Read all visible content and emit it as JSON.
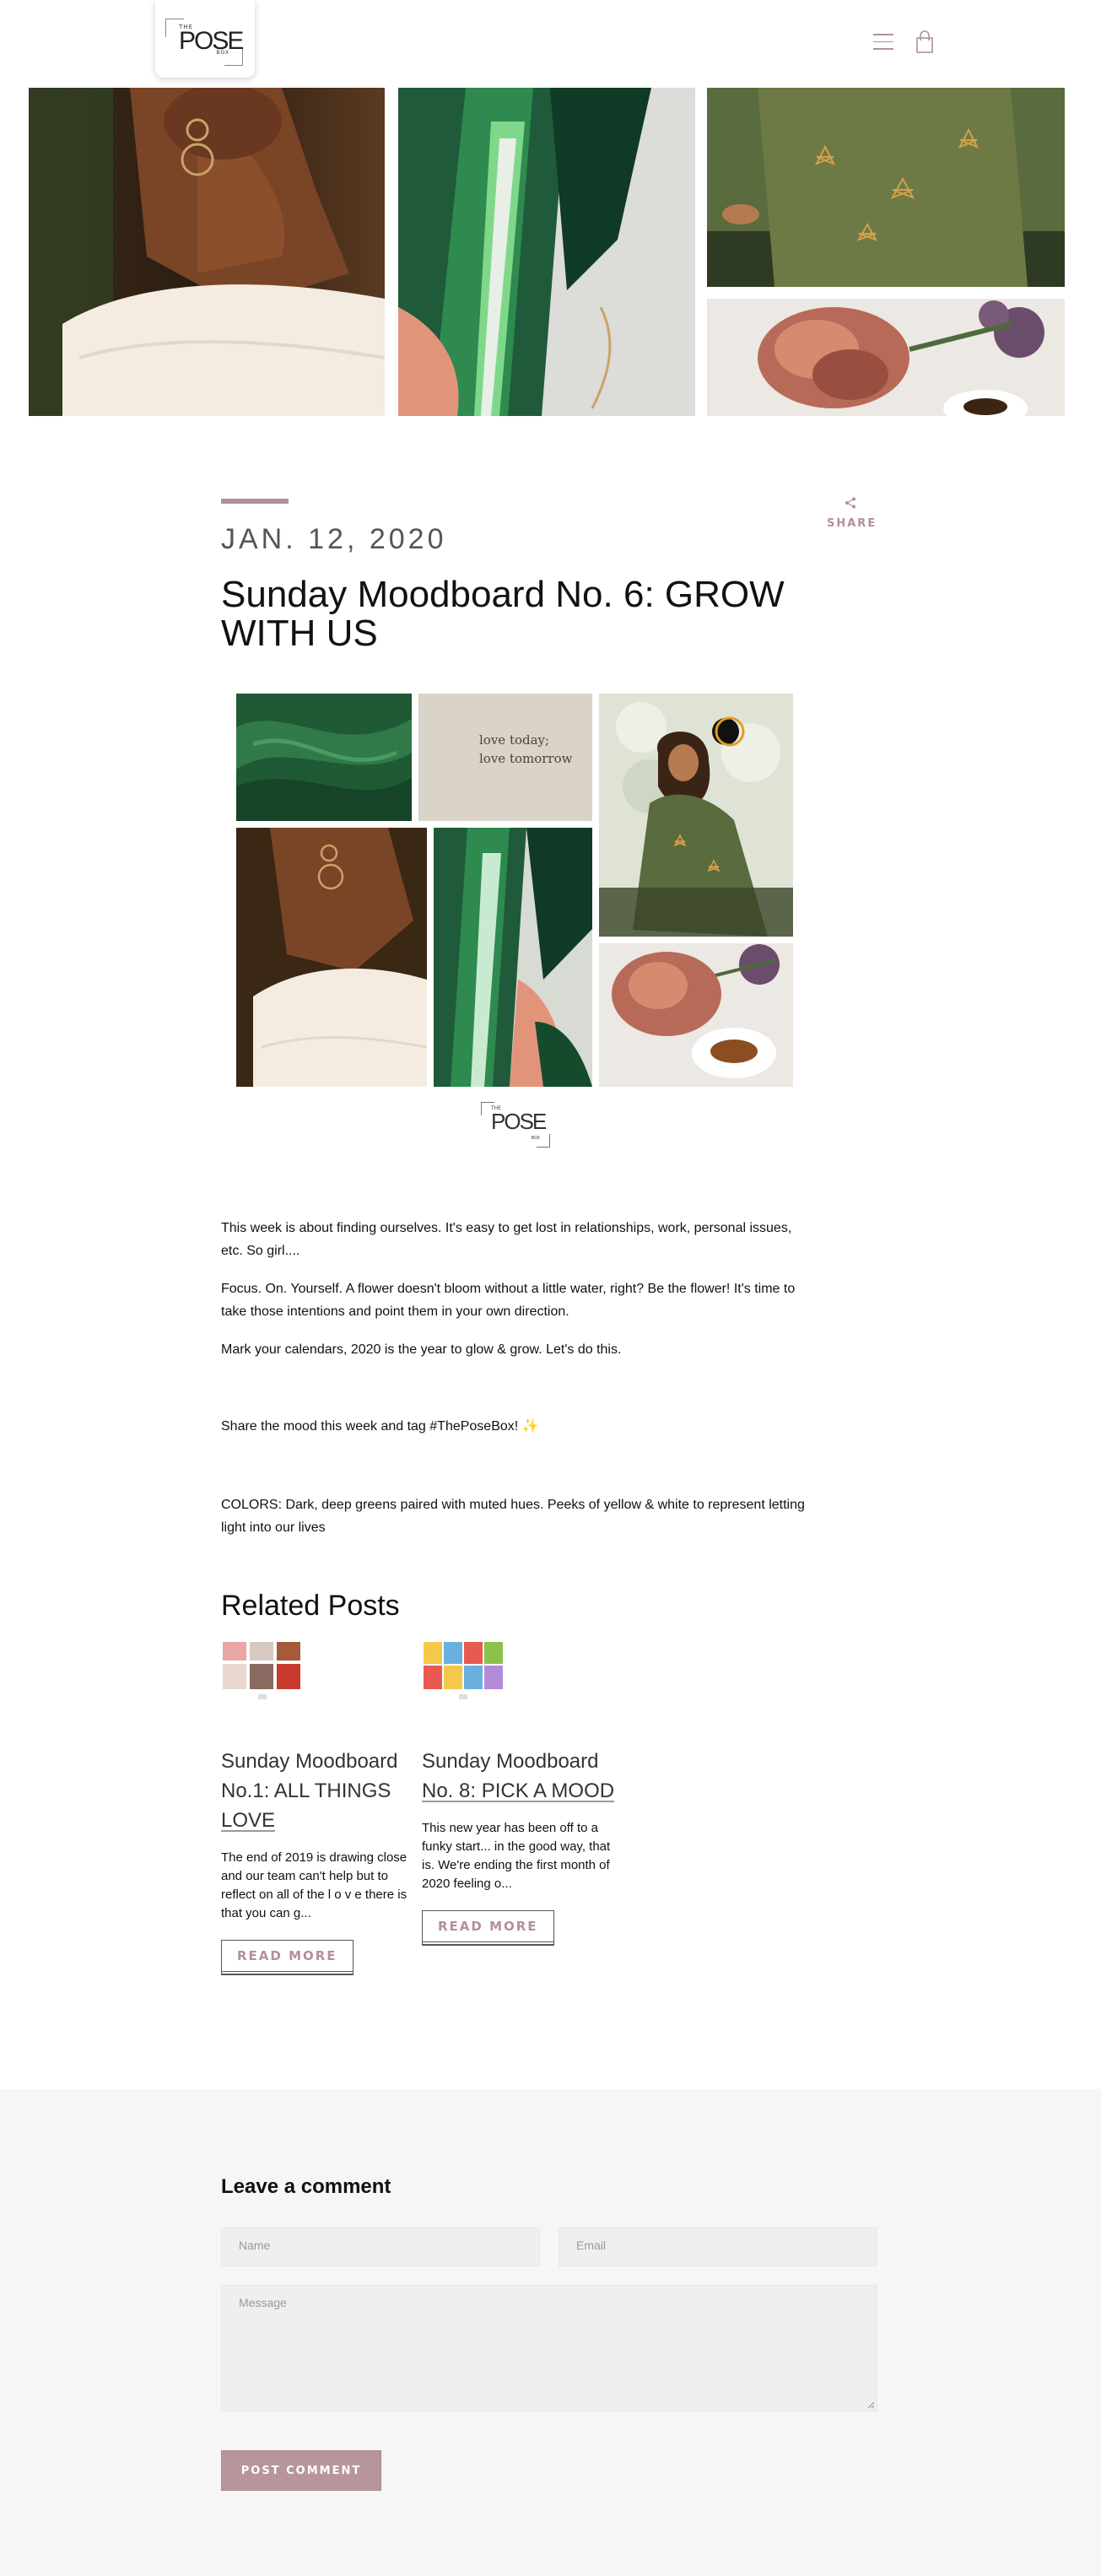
{
  "header": {
    "logo": {
      "the": "THE",
      "pose": "POSE",
      "box": "BOX"
    },
    "menu_icon": "hamburger-menu-icon",
    "cart_icon": "shopping-bag-icon",
    "accent_color": "#b48f98"
  },
  "article": {
    "date": "JAN. 12, 2020",
    "title": "Sunday Moodboard No. 6: GROW WITH US",
    "share_label": "SHARE",
    "collage_text": "love today;\nlove tomorrow",
    "collage_logo": {
      "the": "THE",
      "pose": "POSE",
      "box": "BOX"
    },
    "paragraphs": [
      "This week is about finding ourselves. It's easy to get lost in relationships, work, personal issues, etc. So girl....",
      "Focus. On. Yourself. A flower doesn't bloom without a little water, right? Be the flower! It's time to take those intentions and point them in your own direction.",
      "Mark your calendars, 2020 is the year to glow & grow. Let's do this.",
      "Share the mood this week and tag #ThePoseBox! ✨",
      "COLORS: Dark, deep greens paired with muted hues. Peeks of yellow & white to represent letting light into our lives"
    ]
  },
  "related": {
    "heading": "Related Posts",
    "posts": [
      {
        "title_plain": "Sunday Moodboard No.1: ALL THINGS",
        "title_underlined": "LOVE",
        "excerpt": "The end of 2019 is drawing close and our team can't help but to reflect on all of the l o v e there is that you can g...",
        "read_more": "READ MORE"
      },
      {
        "title_plain": "Sunday Moodboard",
        "title_underlined": "No. 8: PICK A MOOD",
        "excerpt": "This new year has been off to a funky start... in the good way, that is. We're ending the first month of 2020 feeling o...",
        "read_more": "READ MORE"
      }
    ]
  },
  "comments": {
    "heading": "Leave a comment",
    "name_placeholder": "Name",
    "email_placeholder": "Email",
    "message_placeholder": "Message",
    "submit_label": "POST COMMENT"
  }
}
